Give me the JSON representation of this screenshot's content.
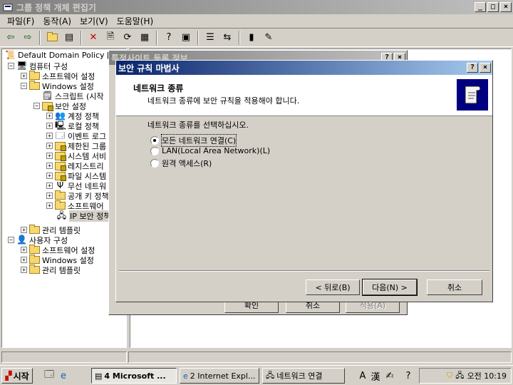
{
  "main_window": {
    "title": "그룹 정책 개체 편집기"
  },
  "menu": [
    "파일(F)",
    "동작(A)",
    "보기(V)",
    "도움말(H)"
  ],
  "tree": {
    "root": "Default Domain Policy [I",
    "computer_config": "컴퓨터 구성",
    "software_settings": "소프트웨어 설정",
    "windows_settings": "Windows 설정",
    "scripts": "스크립트 (시작",
    "security_settings": "보안 설정",
    "account_policy": "계정 정책",
    "local_policy": "로컬 정책",
    "event_log": "이벤트 로그",
    "restricted_groups": "제한된 그룹",
    "system_services": "시스템 서비",
    "registry": "레지스트리",
    "file_system": "파일 시스템",
    "wireless_network": "무선 네트워",
    "public_key": "공개 키 정책",
    "software_restriction": "소프트웨어",
    "ip_security": "IP 보안 정책",
    "admin_templates": "관리 템플릿",
    "user_config": "사용자 구성",
    "user_software": "소프트웨어 설정",
    "user_windows": "Windows 설정",
    "user_admin": "관리 템플릿"
  },
  "props_dialog": {
    "title": "특정사이트 등록 정보",
    "ok": "확인",
    "cancel": "취소",
    "apply": "적용(A)"
  },
  "wizard": {
    "title": "보안 규칙 마법사",
    "header_title": "네트워크 종류",
    "header_subtitle": "네트워크 종류에 보안 규칙을 적용해야 합니다.",
    "prompt": "네트워크 종류를 선택하십시오.",
    "options": [
      {
        "label": "모든 네트워크 연결(C)",
        "selected": true
      },
      {
        "label": "LAN(Local Area Network)(L)",
        "selected": false
      },
      {
        "label": "원격 액세스(R)",
        "selected": false
      }
    ],
    "back": "< 뒤로(B)",
    "next": "다음(N) >",
    "cancel": "취소"
  },
  "taskbar": {
    "start": "시작",
    "tasks": [
      "4 Microsoft ...",
      "2 Internet Expl...",
      "네트워크 연결"
    ],
    "clock": "오전 10:19"
  }
}
